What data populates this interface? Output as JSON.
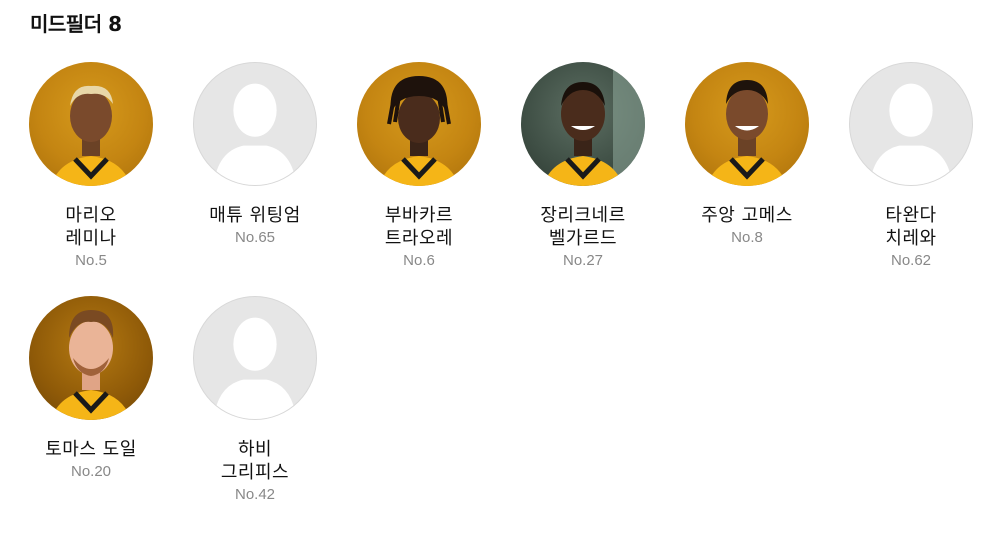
{
  "section": {
    "title": "미드필더 8"
  },
  "colors": {
    "placeholder_bg": "#e6e6e6",
    "kit_gold": "#f5b517",
    "number_text": "#888888"
  },
  "players": [
    {
      "name": "마리오\n레미나",
      "number": "No.5",
      "avatar": "photo",
      "icon": "player-photo"
    },
    {
      "name": "매튜 위팅엄",
      "number": "No.65",
      "avatar": "placeholder",
      "icon": "person-silhouette-icon"
    },
    {
      "name": "부바카르\n트라오레",
      "number": "No.6",
      "avatar": "photo",
      "icon": "player-photo"
    },
    {
      "name": "장리크네르\n벨가르드",
      "number": "No.27",
      "avatar": "photo",
      "icon": "player-photo"
    },
    {
      "name": "주앙 고메스",
      "number": "No.8",
      "avatar": "photo",
      "icon": "player-photo"
    },
    {
      "name": "타완다\n치레와",
      "number": "No.62",
      "avatar": "placeholder",
      "icon": "person-silhouette-icon"
    },
    {
      "name": "토마스 도일",
      "number": "No.20",
      "avatar": "photo",
      "icon": "player-photo"
    },
    {
      "name": "하비\n그리피스",
      "number": "No.42",
      "avatar": "placeholder",
      "icon": "person-silhouette-icon"
    }
  ]
}
